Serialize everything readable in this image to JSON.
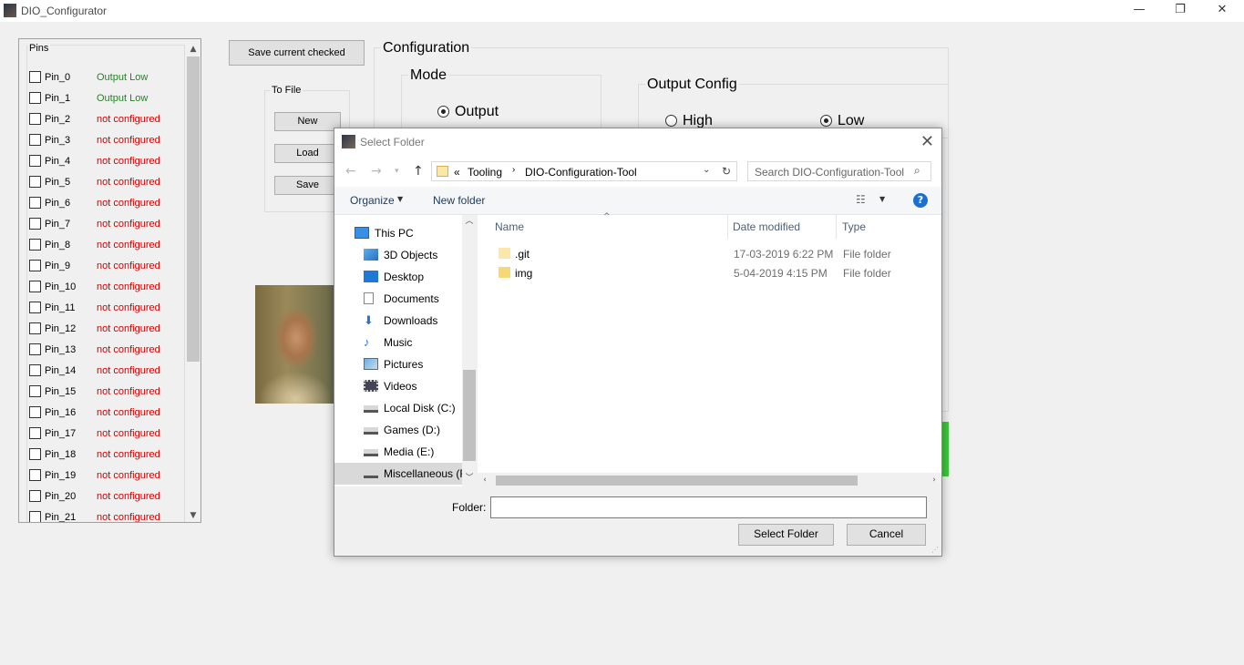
{
  "window": {
    "title": "DIO_Configurator",
    "minimize": "—",
    "maximize": "❐",
    "close": "✕"
  },
  "pins": {
    "title": "Pins",
    "items": [
      {
        "name": "Pin_0",
        "status": "Output Low",
        "color": "#1a8a1a"
      },
      {
        "name": "Pin_1",
        "status": "Output Low",
        "color": "#1a8a1a"
      },
      {
        "name": "Pin_2",
        "status": "not configured",
        "color": "#d40000"
      },
      {
        "name": "Pin_3",
        "status": "not configured",
        "color": "#d40000"
      },
      {
        "name": "Pin_4",
        "status": "not configured",
        "color": "#d40000"
      },
      {
        "name": "Pin_5",
        "status": "not configured",
        "color": "#d40000"
      },
      {
        "name": "Pin_6",
        "status": "not configured",
        "color": "#d40000"
      },
      {
        "name": "Pin_7",
        "status": "not configured",
        "color": "#d40000"
      },
      {
        "name": "Pin_8",
        "status": "not configured",
        "color": "#d40000"
      },
      {
        "name": "Pin_9",
        "status": "not configured",
        "color": "#d40000"
      },
      {
        "name": "Pin_10",
        "status": "not configured",
        "color": "#d40000"
      },
      {
        "name": "Pin_11",
        "status": "not configured",
        "color": "#d40000"
      },
      {
        "name": "Pin_12",
        "status": "not configured",
        "color": "#d40000"
      },
      {
        "name": "Pin_13",
        "status": "not configured",
        "color": "#d40000"
      },
      {
        "name": "Pin_14",
        "status": "not configured",
        "color": "#d40000"
      },
      {
        "name": "Pin_15",
        "status": "not configured",
        "color": "#d40000"
      },
      {
        "name": "Pin_16",
        "status": "not configured",
        "color": "#d40000"
      },
      {
        "name": "Pin_17",
        "status": "not configured",
        "color": "#d40000"
      },
      {
        "name": "Pin_18",
        "status": "not configured",
        "color": "#d40000"
      },
      {
        "name": "Pin_19",
        "status": "not configured",
        "color": "#d40000"
      },
      {
        "name": "Pin_20",
        "status": "not configured",
        "color": "#d40000"
      },
      {
        "name": "Pin_21",
        "status": "not configured",
        "color": "#d40000"
      }
    ]
  },
  "actions": {
    "save_current_checked": "Save current checked"
  },
  "to_file": {
    "title": "To File",
    "new": "New",
    "load": "Load",
    "save": "Save"
  },
  "config": {
    "title": "Configuration",
    "mode": {
      "title": "Mode",
      "output": "Output"
    },
    "output_config": {
      "title": "Output Config",
      "high": "High",
      "low": "Low"
    }
  },
  "dialog": {
    "title": "Select Folder",
    "close": "✕",
    "address": {
      "prefix": "«",
      "crumbs": [
        "Tooling",
        "DIO-Configuration-Tool"
      ]
    },
    "search_placeholder": "Search DIO-Configuration-Tool",
    "toolbar": {
      "organize": "Organize",
      "new_folder": "New folder",
      "help": "?"
    },
    "nav": [
      {
        "label": "This PC",
        "icon": "pc-icon"
      },
      {
        "label": "3D Objects",
        "icon": "cube-icon"
      },
      {
        "label": "Desktop",
        "icon": "desktop-icon"
      },
      {
        "label": "Documents",
        "icon": "document-icon"
      },
      {
        "label": "Downloads",
        "icon": "download-icon"
      },
      {
        "label": "Music",
        "icon": "music-icon"
      },
      {
        "label": "Pictures",
        "icon": "pictures-icon"
      },
      {
        "label": "Videos",
        "icon": "video-icon"
      },
      {
        "label": "Local Disk (C:)",
        "icon": "drive-icon"
      },
      {
        "label": "Games (D:)",
        "icon": "drive-icon"
      },
      {
        "label": "Media (E:)",
        "icon": "drive-icon"
      },
      {
        "label": "Miscellaneous (F",
        "icon": "drive-icon"
      }
    ],
    "columns": {
      "name": "Name",
      "date": "Date modified",
      "type": "Type"
    },
    "files": [
      {
        "name": ".git",
        "date": "17-03-2019 6:22 PM",
        "type": "File folder"
      },
      {
        "name": "img",
        "date": "5-04-2019 4:15 PM",
        "type": "File folder"
      }
    ],
    "folder_label": "Folder:",
    "folder_value": "",
    "select_button": "Select Folder",
    "cancel_button": "Cancel"
  }
}
